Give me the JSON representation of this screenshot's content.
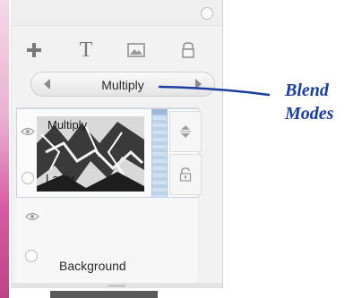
{
  "panel": {
    "toolbar_icons": [
      "add-icon",
      "text-icon",
      "image-icon",
      "eraser-icon"
    ],
    "text_tool_label": "T"
  },
  "blend": {
    "label": "Multiply"
  },
  "layers": [
    {
      "name": "Multiply",
      "sublabel": "Layer",
      "selected": true
    },
    {
      "name": "",
      "selected": false
    },
    {
      "name": "Background",
      "selected": false
    }
  ],
  "annotation": {
    "line1": "Blend",
    "line2": "Modes"
  },
  "colors": {
    "annotation": "#1a3fa0",
    "selection_strip": "#cfe1f3"
  }
}
